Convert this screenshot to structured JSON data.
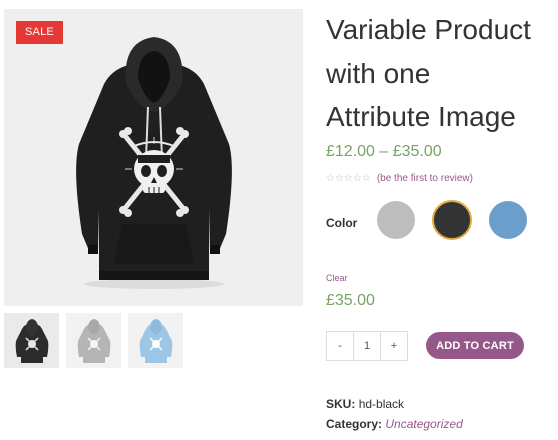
{
  "product": {
    "title_lines": [
      "Variable Product",
      "with one",
      "Attribute Image"
    ],
    "sale_badge": "SALE",
    "price_range": "£12.00 – £35.00",
    "review_link": "(be the first to review)",
    "stars_icon": "☆☆☆☆☆",
    "rating_stars": 0,
    "attribute_label": "Color",
    "swatches": [
      {
        "name": "gray",
        "color": "#bdbdbd",
        "selected": false
      },
      {
        "name": "black",
        "color": "#333333",
        "selected": true
      },
      {
        "name": "blue",
        "color": "#6a9ecb",
        "selected": false
      }
    ],
    "clear_label": "Clear",
    "variation_price": "£35.00",
    "quantity": {
      "minus": "-",
      "value": "1",
      "plus": "+"
    },
    "add_to_cart_label": "ADD TO CART",
    "sku_label": "SKU:",
    "sku_value": "hd-black",
    "category_label": "Category:",
    "category_value": "Uncategorized"
  },
  "gallery": {
    "thumbnails": [
      {
        "name": "black-hoodie",
        "color": "#2c2c2c"
      },
      {
        "name": "gray-hoodie",
        "color": "#b5b5b5"
      },
      {
        "name": "blue-hoodie",
        "color": "#9ec6e6"
      }
    ]
  },
  "colors": {
    "accent": "#96588a",
    "price": "#77a464",
    "sale": "#e53935",
    "selected_border": "#e0a93d"
  }
}
